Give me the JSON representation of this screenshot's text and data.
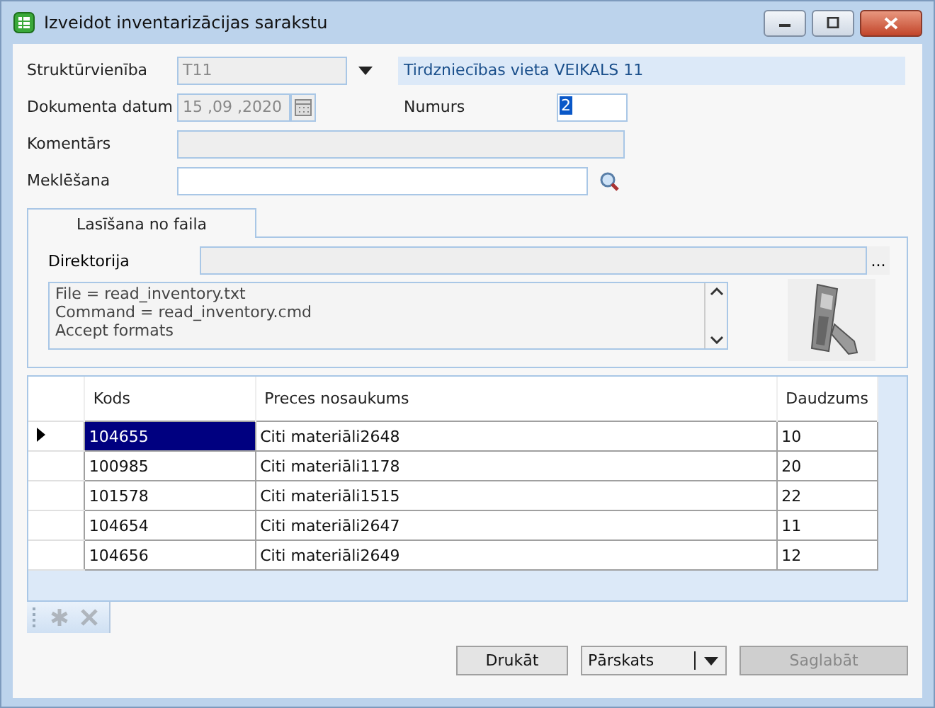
{
  "window": {
    "title": "Izveidot inventarizācijas sarakstu"
  },
  "form": {
    "unit": {
      "label": "Struktūrvienība",
      "value": "T11",
      "disabled": true,
      "info": "Tirdzniecības vieta VEIKALS 11"
    },
    "date": {
      "label": "Dokumenta datum",
      "value": "15 ,09 ,2020",
      "disabled": true
    },
    "number": {
      "label": "Numurs",
      "value": "2"
    },
    "comment": {
      "label": "Komentārs",
      "disabled": true
    },
    "search": {
      "label": "Meklēšana"
    }
  },
  "tabs": [
    {
      "label": "Lasīšana no faila",
      "selected": true
    }
  ],
  "file_panel": {
    "directory_label": "Direktorija",
    "browse": "...",
    "config_lines": [
      "File = read_inventory.txt",
      "Command = read_inventory.cmd",
      "Accept formats"
    ]
  },
  "table": {
    "columns": [
      "Kods",
      "Preces nosaukums",
      "Daudzums"
    ],
    "rows": [
      {
        "cells": [
          "104655",
          "Citi materiāli2648",
          "10"
        ],
        "selected": true
      },
      {
        "cells": [
          "100985",
          "Citi materiāli1178",
          "20"
        ],
        "selected": false
      },
      {
        "cells": [
          "101578",
          "Citi materiāli1515",
          "22"
        ],
        "selected": false
      },
      {
        "cells": [
          "104654",
          "Citi materiāli2647",
          "11"
        ],
        "selected": false
      },
      {
        "cells": [
          "104656",
          "Citi materiāli2649",
          "12"
        ],
        "selected": false
      }
    ]
  },
  "toolbar": [
    {
      "kind": "add",
      "disabled": true
    },
    {
      "kind": "delete",
      "disabled": true
    }
  ],
  "buttons": [
    {
      "label": "Drukāt",
      "kind": "button",
      "disabled": false
    },
    {
      "label": "Pārskats",
      "kind": "dropdown",
      "disabled": false
    },
    {
      "label": "Saglabāt",
      "kind": "button",
      "disabled": true
    }
  ]
}
